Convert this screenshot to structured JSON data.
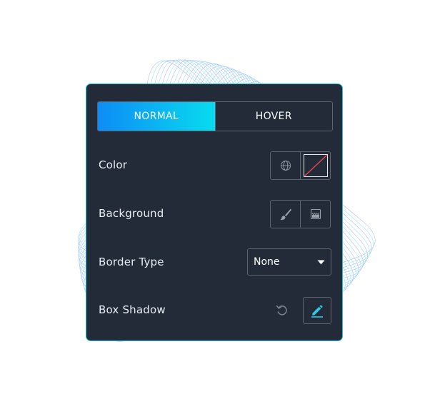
{
  "tabs": {
    "normal": "NORMAL",
    "hover": "HOVER",
    "active": "normal"
  },
  "rows": {
    "color": {
      "label": "Color"
    },
    "background": {
      "label": "Background"
    },
    "border_type": {
      "label": "Border Type",
      "value": "None"
    },
    "box_shadow": {
      "label": "Box Shadow"
    }
  },
  "icons": {
    "color_global": "globe-icon",
    "color_none": "no-color-swatch-icon",
    "background_classic": "paint-brush-icon",
    "background_gradient": "gradient-icon",
    "border_dropdown": "caret-down-icon",
    "shadow_reset": "reset-icon",
    "shadow_edit": "pencil-icon"
  },
  "colors": {
    "panel_bg": "#232b38",
    "panel_border": "#23c1d8",
    "tab_gradient_start": "#0d8cf6",
    "tab_gradient_end": "#08dcee",
    "no_color_slash": "#e8474f",
    "edit_accent": "#2ec8e8"
  }
}
